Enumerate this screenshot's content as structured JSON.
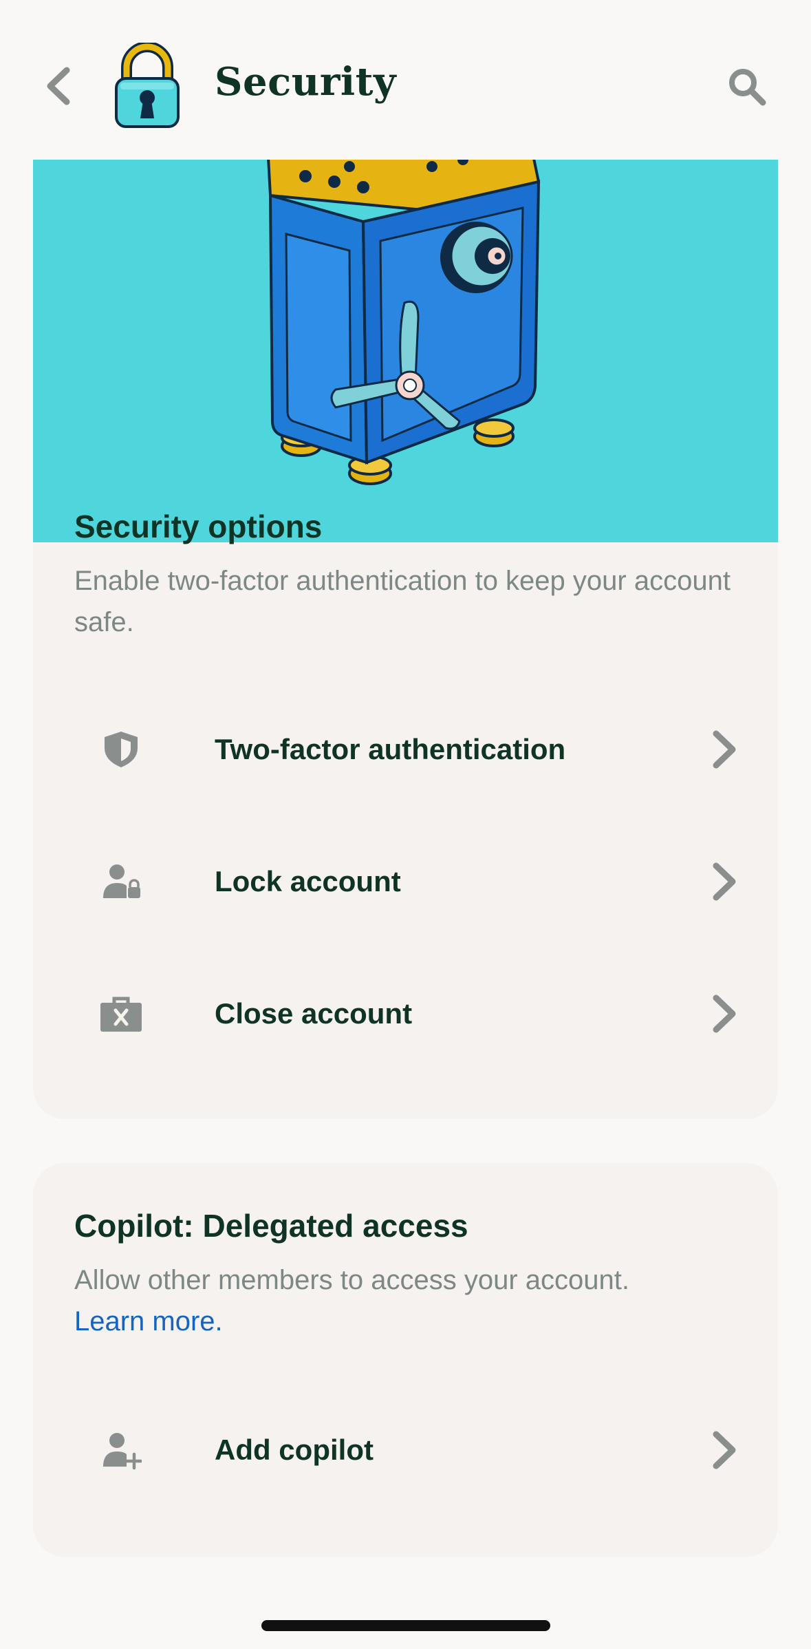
{
  "header": {
    "title": "Security",
    "back_icon": "chevron-left-icon",
    "logo_icon": "padlock-icon",
    "search_icon": "search-icon"
  },
  "hero": {
    "illustration": "safe-illustration",
    "background": "#4fd6dc"
  },
  "security_options": {
    "title": "Security options",
    "description": "Enable two-factor authentication to keep your account safe.",
    "items": [
      {
        "label": "Two-factor authentication",
        "icon": "shield-icon"
      },
      {
        "label": "Lock account",
        "icon": "user-lock-icon"
      },
      {
        "label": "Close account",
        "icon": "briefcase-x-icon"
      }
    ]
  },
  "copilot": {
    "title": "Copilot: Delegated access",
    "description": "Allow other members to access your account.",
    "link": "Learn more.",
    "items": [
      {
        "label": "Add copilot",
        "icon": "user-plus-icon"
      }
    ]
  },
  "colors": {
    "primary_text": "#0f3324",
    "secondary_text": "#7d8784",
    "link": "#1565c0",
    "card": "#f5f2ef"
  }
}
